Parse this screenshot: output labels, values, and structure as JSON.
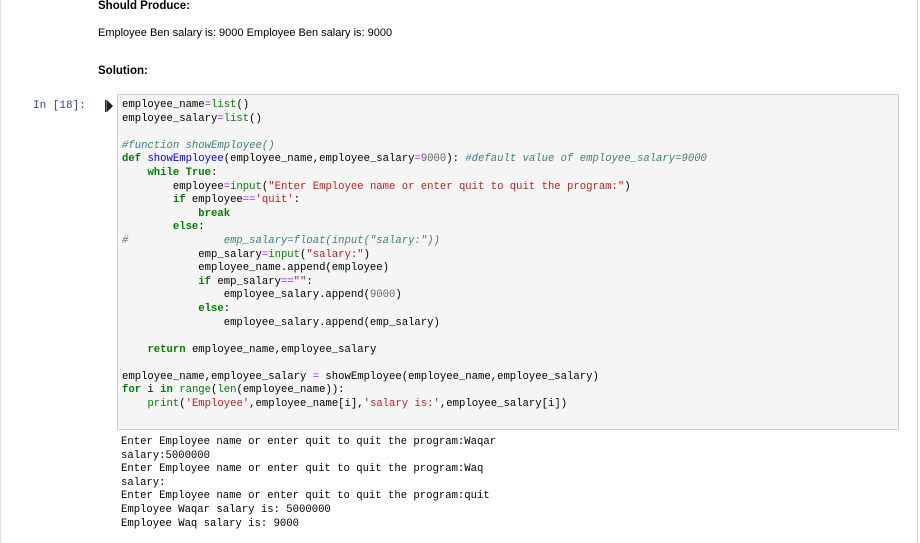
{
  "markdown": {
    "heading_produce": "Should Produce:",
    "expected_output": "Employee Ben salary is: 9000 Employee Ben salary is: 9000",
    "heading_solution": "Solution:"
  },
  "cell": {
    "prompt": "In [18]:",
    "code_lines": [
      "employee_name=list()",
      "employee_salary=list()",
      "",
      "#function showEmployee()",
      "def showEmployee(employee_name,employee_salary=9000): #default value of employee_salary=9000",
      "    while True:",
      "        employee=input(\"Enter Employee name or enter quit to quit the program:\")",
      "        if employee=='quit':",
      "            break",
      "        else:",
      "#               emp_salary=float(input(\"salary:\"))",
      "            emp_salary=input(\"salary:\")",
      "            employee_name.append(employee)",
      "            if emp_salary==\"\":",
      "                employee_salary.append(9000)",
      "            else:",
      "                employee_salary.append(emp_salary)",
      "",
      "    return employee_name,employee_salary",
      "",
      "employee_name,employee_salary = showEmployee(employee_name,employee_salary)",
      "for i in range(len(employee_name)):",
      "    print('Employee',employee_name[i],'salary is:',employee_salary[i])"
    ],
    "output_lines": [
      "Enter Employee name or enter quit to quit the program:Waqar",
      "salary:5000000",
      "Enter Employee name or enter quit to quit the program:Waq",
      "salary:",
      "Enter Employee name or enter quit to quit the program:quit",
      "Employee Waqar salary is: 5000000",
      "Employee Waq salary is: 9000"
    ]
  }
}
